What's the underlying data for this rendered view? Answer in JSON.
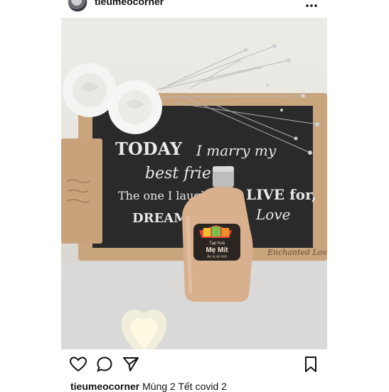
{
  "post": {
    "username": "tieumeocorner",
    "caption_user": "tieumeocorner",
    "caption_text": " Mùng 2 Tết covid 2",
    "photo": {
      "chalkboard_lines": [
        "TODAY",
        "I marry my",
        "best friend",
        "The one I laugh with",
        "LIVE for,",
        "DREAM",
        "Love"
      ],
      "tag_text": "Enchanted Love",
      "label_line1": "Tạp hoá",
      "label_name": "Mẹ Mít",
      "label_line3": "Ăn là đủ thôi"
    }
  },
  "icons": {
    "more": "more-dots-icon",
    "like": "heart-icon",
    "comment": "comment-bubble-icon",
    "share": "paper-plane-icon",
    "save": "bookmark-icon"
  },
  "colors": {
    "text": "#111111",
    "chalkboard": "#2a2a2a",
    "frame": "#c9a57e",
    "milk_tea": "#d8b08e"
  }
}
